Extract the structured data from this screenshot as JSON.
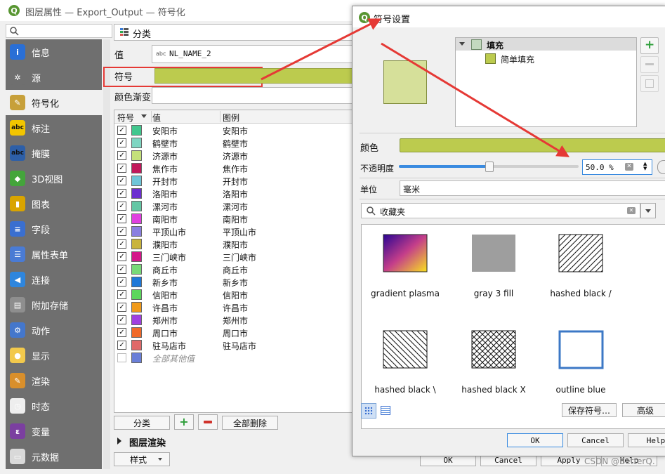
{
  "main_window": {
    "title": "图层属性 — Export_Output — 符号化",
    "renderer": "分类",
    "value_label": "值",
    "value_field": "NL_NAME_2",
    "symbol_label": "符号",
    "color_ramp_label": "颜色渐变",
    "columns": [
      "符号",
      "值",
      "图例"
    ],
    "rows": [
      {
        "value": "安阳市",
        "legend": "安阳市",
        "color": "#41c78e"
      },
      {
        "value": "鹤壁市",
        "legend": "鹤壁市",
        "color": "#7fd6c2"
      },
      {
        "value": "济源市",
        "legend": "济源市",
        "color": "#c4e07a"
      },
      {
        "value": "焦作市",
        "legend": "焦作市",
        "color": "#c2185b"
      },
      {
        "value": "开封市",
        "legend": "开封市",
        "color": "#6ec6d8"
      },
      {
        "value": "洛阳市",
        "legend": "洛阳市",
        "color": "#6b2fd0"
      },
      {
        "value": "漯河市",
        "legend": "漯河市",
        "color": "#63c7a5"
      },
      {
        "value": "南阳市",
        "legend": "南阳市",
        "color": "#e040e0"
      },
      {
        "value": "平顶山市",
        "legend": "平顶山市",
        "color": "#8a7fe0"
      },
      {
        "value": "濮阳市",
        "legend": "濮阳市",
        "color": "#c9b43c"
      },
      {
        "value": "三门峡市",
        "legend": "三门峡市",
        "color": "#d4178a"
      },
      {
        "value": "商丘市",
        "legend": "商丘市",
        "color": "#78d978"
      },
      {
        "value": "新乡市",
        "legend": "新乡市",
        "color": "#1e78d8"
      },
      {
        "value": "信阳市",
        "legend": "信阳市",
        "color": "#5cd65c"
      },
      {
        "value": "许昌市",
        "legend": "许昌市",
        "color": "#f09a1a"
      },
      {
        "value": "郑州市",
        "legend": "郑州市",
        "color": "#a040e0"
      },
      {
        "value": "周口市",
        "legend": "周口市",
        "color": "#f06a2a"
      },
      {
        "value": "驻马店市",
        "legend": "驻马店市",
        "color": "#e06a6a"
      }
    ],
    "all_other_values": "全部其他值",
    "all_other_color": "#6a7fd8",
    "classify_button": "分类",
    "delete_all_button": "全部删除",
    "layer_rendering": "图层渲染",
    "style_button": "样式",
    "ok_button": "OK",
    "cancel_button": "Cancel",
    "apply_button": "Apply",
    "help_button": "Help",
    "symbol_color": "#bccb4e"
  },
  "sidebar": {
    "items": [
      {
        "label": "信息",
        "icon": "info-icon",
        "color": "#2a6fd6",
        "glyph": "i"
      },
      {
        "label": "源",
        "icon": "wrench-icon",
        "color": "#6f6f6f",
        "glyph": "✲"
      },
      {
        "label": "符号化",
        "icon": "paintbrush-icon",
        "color": "#c7a03a",
        "glyph": "✎"
      },
      {
        "label": "标注",
        "icon": "label-abc-icon",
        "color": "#f2c500",
        "glyph": "abc"
      },
      {
        "label": "掩膜",
        "icon": "mask-abc-icon",
        "color": "#2d5fa8",
        "glyph": "abc"
      },
      {
        "label": "3D视图",
        "icon": "cube-3d-icon",
        "color": "#44a53b",
        "glyph": "◆"
      },
      {
        "label": "图表",
        "icon": "diagram-icon",
        "color": "#d9a400",
        "glyph": "▮"
      },
      {
        "label": "字段",
        "icon": "fields-icon",
        "color": "#3a6fd0",
        "glyph": "≡"
      },
      {
        "label": "属性表单",
        "icon": "form-icon",
        "color": "#4a7bd4",
        "glyph": "☰"
      },
      {
        "label": "连接",
        "icon": "join-icon",
        "color": "#2e86de",
        "glyph": "◀"
      },
      {
        "label": "附加存储",
        "icon": "storage-icon",
        "color": "#8e8e8e",
        "glyph": "▤"
      },
      {
        "label": "动作",
        "icon": "action-gear-icon",
        "color": "#4477cc",
        "glyph": "⚙"
      },
      {
        "label": "显示",
        "icon": "display-bubble-icon",
        "color": "#f2c94c",
        "glyph": "●"
      },
      {
        "label": "渲染",
        "icon": "render-brush-icon",
        "color": "#d98f2b",
        "glyph": "✎"
      },
      {
        "label": "时态",
        "icon": "clock-icon",
        "color": "#eeeeee",
        "glyph": "◷"
      },
      {
        "label": "变量",
        "icon": "epsilon-icon",
        "color": "#7b3fa0",
        "glyph": "ε"
      },
      {
        "label": "元数据",
        "icon": "metadata-icon",
        "color": "#d9d9d9",
        "glyph": "▭"
      }
    ]
  },
  "dialog": {
    "title": "符号设置",
    "tree_root": "填充",
    "tree_child": "简单填充",
    "fill_color": "#bccb4e",
    "preview_color": "#d6e09a",
    "color_label": "颜色",
    "opacity_label": "不透明度",
    "opacity_value": "50.0 %",
    "opacity_fraction": 0.5,
    "unit_label": "单位",
    "unit_value": "毫米",
    "favorites": "收藏夹",
    "library": [
      {
        "label": "gradient  plasma",
        "kind": "gradient"
      },
      {
        "label": "gray 3 fill",
        "kind": "gray"
      },
      {
        "label": "hashed black /",
        "kind": "fwd"
      },
      {
        "label": "hashed black \\",
        "kind": "back"
      },
      {
        "label": "hashed black X",
        "kind": "cross"
      },
      {
        "label": "outline blue",
        "kind": "outline"
      }
    ],
    "save_symbol": "保存符号…",
    "advanced": "高级",
    "ok": "OK",
    "cancel": "Cancel",
    "help": "Help"
  },
  "watermark": "CSDN @BetterQ."
}
